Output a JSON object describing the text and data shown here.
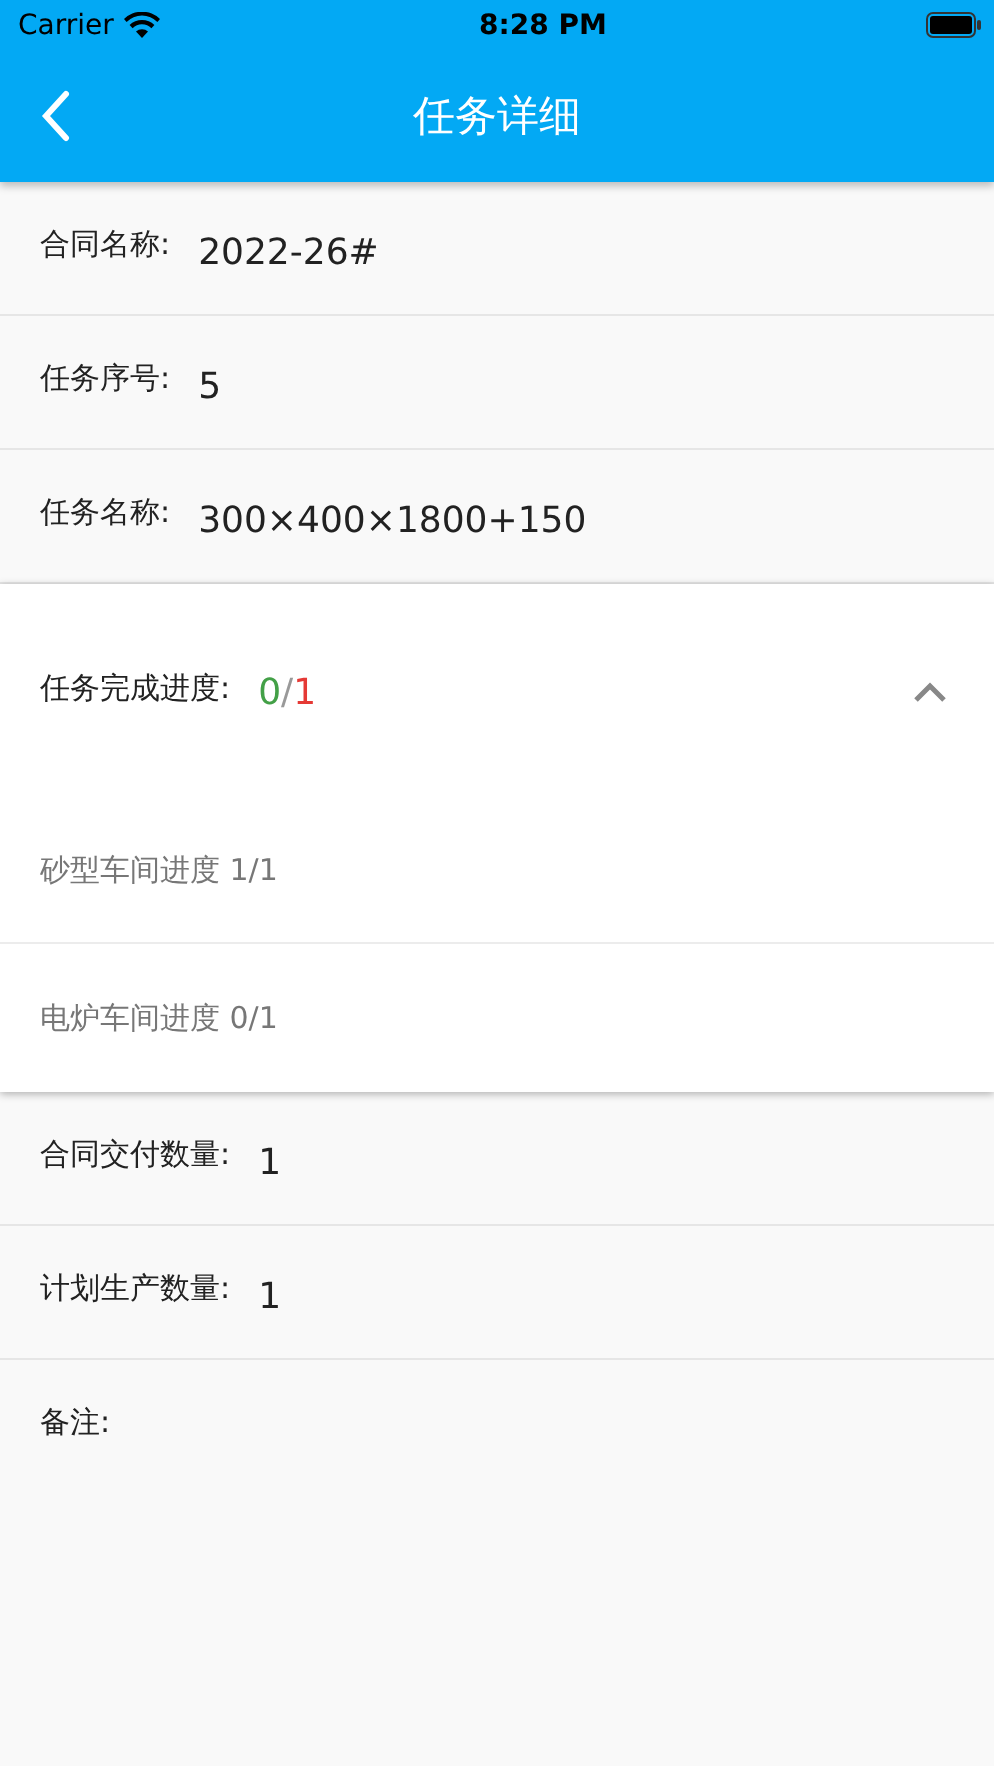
{
  "status_bar": {
    "carrier": "Carrier",
    "time": "8:28 PM"
  },
  "nav": {
    "title": "任务详细"
  },
  "fields_top": [
    {
      "label": "合同名称:",
      "value": "2022-26#"
    },
    {
      "label": "任务序号:",
      "value": "5"
    },
    {
      "label": "任务名称:",
      "value": "300×400×1800+150"
    }
  ],
  "progress": {
    "label": "任务完成进度:",
    "done": "0",
    "separator": "/",
    "total": "1",
    "expanded": true,
    "items": [
      {
        "text": "砂型车间进度 1/1"
      },
      {
        "text": "电炉车间进度 0/1"
      }
    ]
  },
  "fields_bottom": [
    {
      "label": "合同交付数量:",
      "value": "1"
    },
    {
      "label": "计划生产数量:",
      "value": "1"
    },
    {
      "label": "备注:"
    }
  ]
}
